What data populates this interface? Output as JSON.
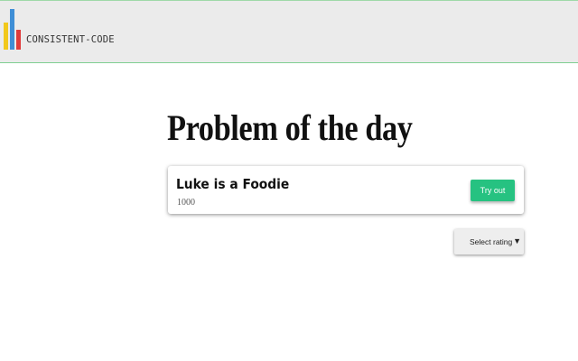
{
  "header": {
    "brand": "CONSISTENT-CODE",
    "logo_colors": {
      "yellow": "#f2c81b",
      "blue": "#3f8ed6",
      "red": "#e03c3c"
    },
    "border_color": "#7fcf92"
  },
  "main": {
    "title": "Problem of the day",
    "problem": {
      "name": "Luke is a Foodie",
      "rating": "1000",
      "action_label": "Try out"
    },
    "filter": {
      "selected": "Select rating",
      "icon": "chevron-down-icon"
    }
  },
  "colors": {
    "accent": "#26c281",
    "header_bg": "#ebebeb"
  }
}
